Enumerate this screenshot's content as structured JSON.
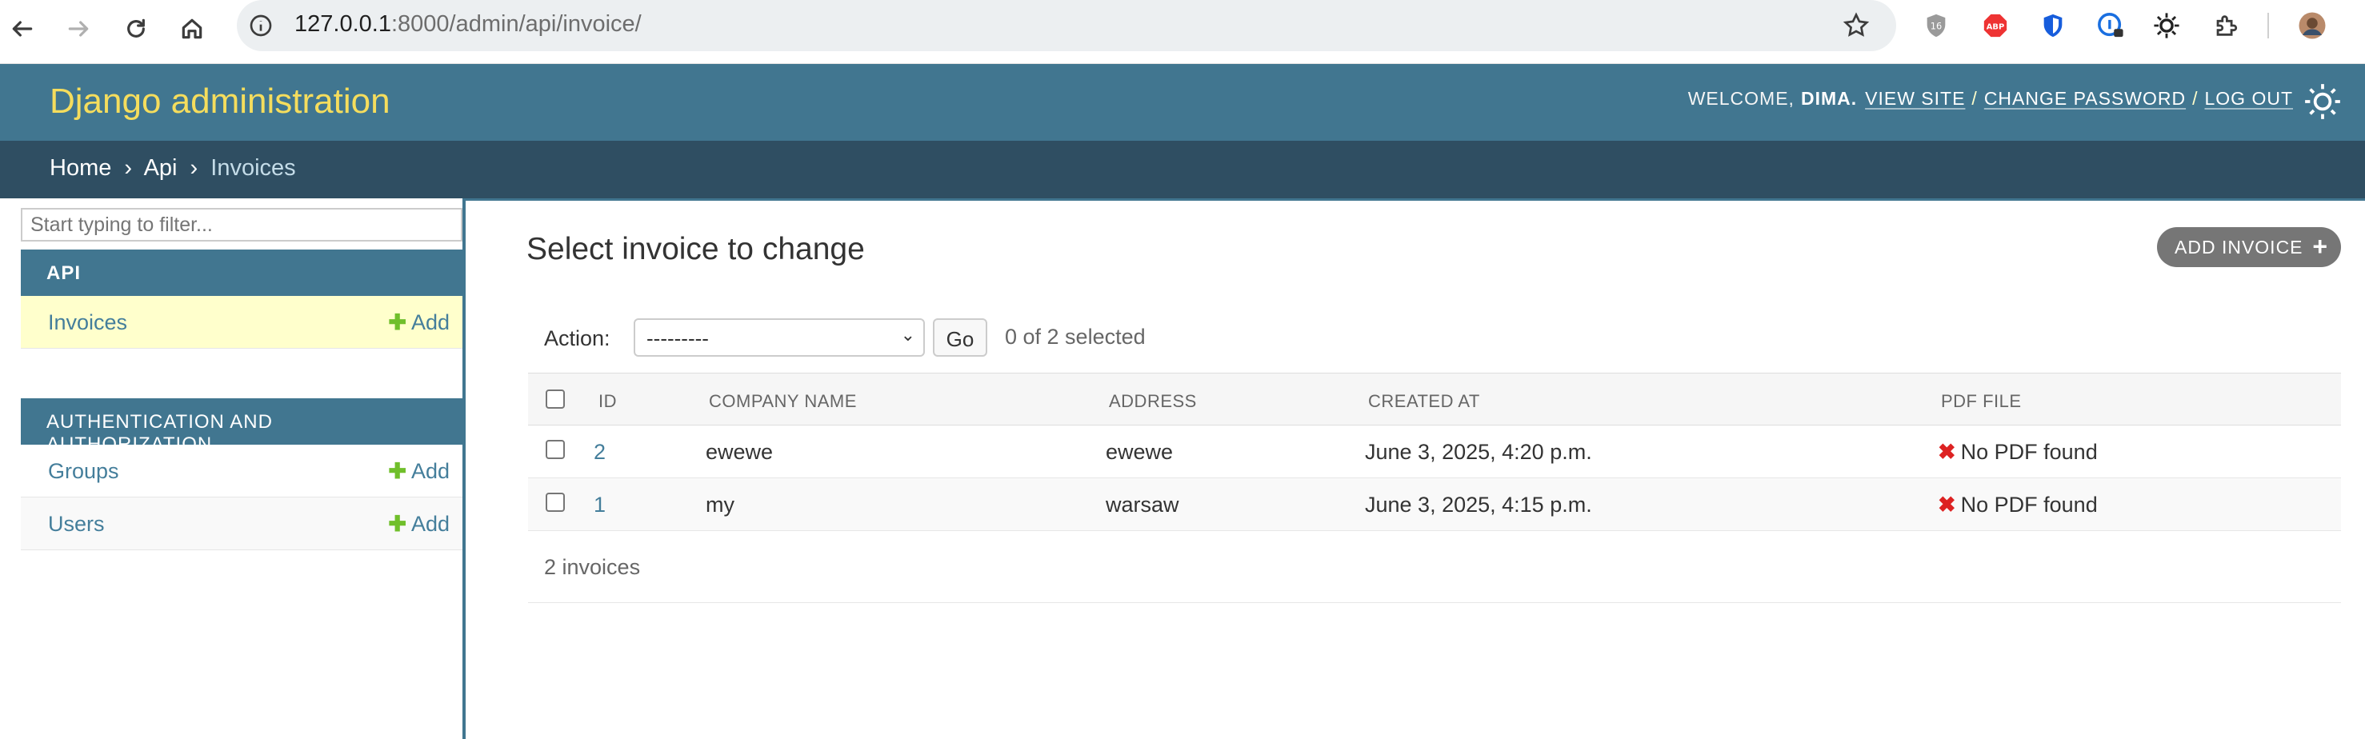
{
  "browser": {
    "url_host": "127.0.0.1",
    "url_path": ":8000/admin/api/invoice/",
    "extensions": [
      "brave-shield-icon",
      "adblock-icon",
      "bitwarden-icon",
      "1password-icon",
      "sun-ext-icon",
      "puzzle-icon",
      "profile-avatar"
    ]
  },
  "header": {
    "brand": "Django administration",
    "welcome": "WELCOME,",
    "username": "DIMA.",
    "view_site": "VIEW SITE",
    "change_password": "CHANGE PASSWORD",
    "log_out": "LOG OUT",
    "sep": "/"
  },
  "breadcrumbs": {
    "home": "Home",
    "sep": "›",
    "app": "Api",
    "current": "Invoices"
  },
  "sidebar": {
    "filter_placeholder": "Start typing to filter...",
    "apps": [
      {
        "caption": "API",
        "models": [
          {
            "name": "Invoices",
            "add": "Add"
          }
        ]
      },
      {
        "caption": "AUTHENTICATION AND AUTHORIZATION",
        "models": [
          {
            "name": "Groups",
            "add": "Add"
          },
          {
            "name": "Users",
            "add": "Add"
          }
        ]
      }
    ]
  },
  "content": {
    "title": "Select invoice to change",
    "add_button": "ADD INVOICE",
    "action_label": "Action:",
    "action_selected": "---------",
    "go": "Go",
    "selected_count": "0 of 2 selected",
    "columns": [
      "ID",
      "COMPANY NAME",
      "ADDRESS",
      "CREATED AT",
      "PDF FILE"
    ],
    "rows": [
      {
        "id": "2",
        "company": "ewewe",
        "address": "ewewe",
        "created": "June 3, 2025, 4:20 p.m.",
        "pdf": "No PDF found"
      },
      {
        "id": "1",
        "company": "my",
        "address": "warsaw",
        "created": "June 3, 2025, 4:15 p.m.",
        "pdf": "No PDF found"
      }
    ],
    "paginator": "2 invoices"
  },
  "colors": {
    "header_bg": "#417690",
    "breadcrumb_bg": "#2f4e62",
    "brand": "#f5dd5d",
    "link": "#447e9b",
    "add_plus": "#70bf2b",
    "current_row": "#ffffcc",
    "error_x": "#dd2222"
  }
}
